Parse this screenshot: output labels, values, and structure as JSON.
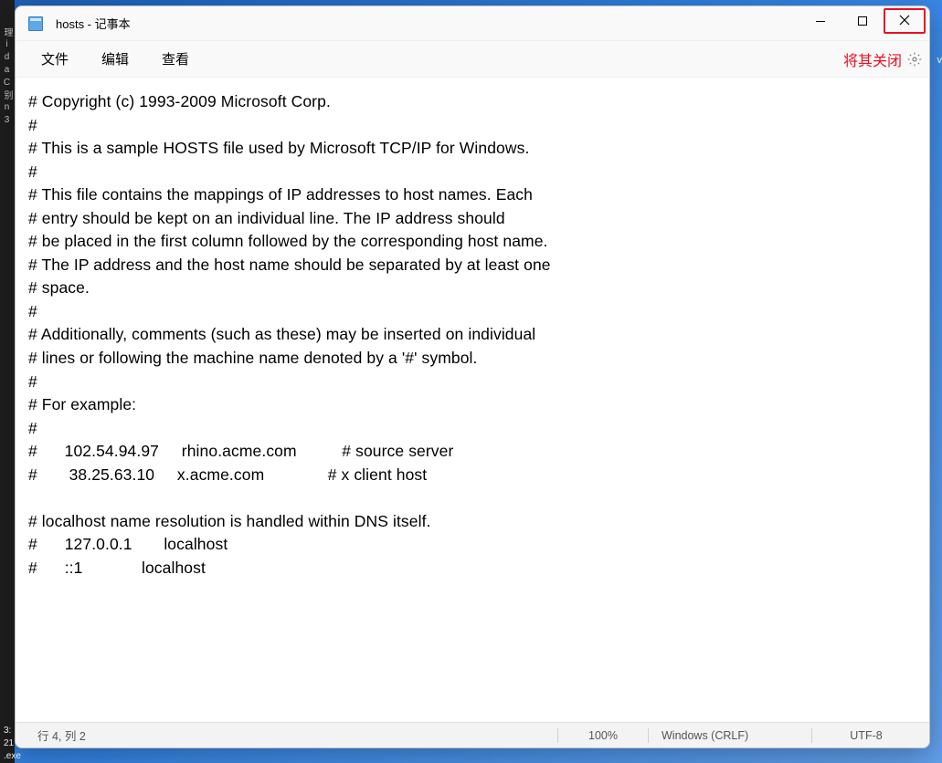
{
  "window": {
    "title": "hosts - 记事本"
  },
  "menubar": {
    "file": "文件",
    "edit": "编辑",
    "view": "查看"
  },
  "annotation": {
    "close_label": "将其关闭"
  },
  "content": {
    "text": "# Copyright (c) 1993-2009 Microsoft Corp.\n#\n# This is a sample HOSTS file used by Microsoft TCP/IP for Windows.\n#\n# This file contains the mappings of IP addresses to host names. Each\n# entry should be kept on an individual line. The IP address should\n# be placed in the first column followed by the corresponding host name.\n# The IP address and the host name should be separated by at least one\n# space.\n#\n# Additionally, comments (such as these) may be inserted on individual\n# lines or following the machine name denoted by a '#' symbol.\n#\n# For example:\n#\n#      102.54.94.97     rhino.acme.com          # source server\n#       38.25.63.10     x.acme.com              # x client host\n\n# localhost name resolution is handled within DNS itself.\n#\t127.0.0.1       localhost\n#\t::1             localhost"
  },
  "statusbar": {
    "cursor_position": "行 4, 列 2",
    "zoom": "100%",
    "line_ending": "Windows (CRLF)",
    "encoding": "UTF-8"
  },
  "background": {
    "left_strip": "理\ni\nd\na\nC\n别\nn\n3",
    "bottom_left1": "3:",
    "bottom_left2": "21",
    "bottom_left3": ".exe",
    "right_char": "v"
  }
}
